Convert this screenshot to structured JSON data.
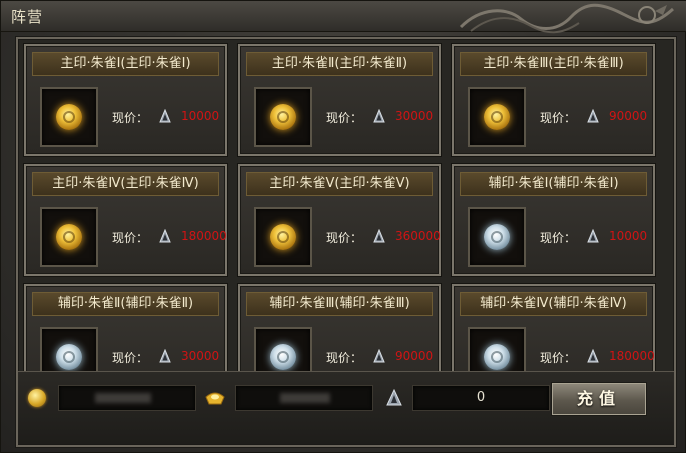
{
  "window": {
    "title": "阵营"
  },
  "cards": [
    {
      "title": "主印·朱雀Ⅰ(主印·朱雀Ⅰ)",
      "price_label": "现价：",
      "price": "10000",
      "seal": "gold"
    },
    {
      "title": "主印·朱雀Ⅱ(主印·朱雀Ⅱ)",
      "price_label": "现价：",
      "price": "30000",
      "seal": "gold"
    },
    {
      "title": "主印·朱雀Ⅲ(主印·朱雀Ⅲ)",
      "price_label": "现价：",
      "price": "90000",
      "seal": "gold"
    },
    {
      "title": "主印·朱雀Ⅳ(主印·朱雀Ⅳ)",
      "price_label": "现价：",
      "price": "180000",
      "seal": "gold"
    },
    {
      "title": "主印·朱雀Ⅴ(主印·朱雀Ⅴ)",
      "price_label": "现价：",
      "price": "360000",
      "seal": "gold"
    },
    {
      "title": "辅印·朱雀Ⅰ(辅印·朱雀Ⅰ)",
      "price_label": "现价：",
      "price": "10000",
      "seal": "silver"
    },
    {
      "title": "辅印·朱雀Ⅱ(辅印·朱雀Ⅱ)",
      "price_label": "现价：",
      "price": "30000",
      "seal": "silver"
    },
    {
      "title": "辅印·朱雀Ⅲ(辅印·朱雀Ⅲ)",
      "price_label": "现价：",
      "price": "90000",
      "seal": "silver"
    },
    {
      "title": "辅印·朱雀Ⅳ(辅印·朱雀Ⅳ)",
      "price_label": "现价：",
      "price": "180000",
      "seal": "silver"
    }
  ],
  "bottom": {
    "recharge_amount": "0",
    "recharge_label": "充值"
  },
  "icons": {
    "gold": "gold-coin-icon",
    "ingot": "gold-ingot-icon",
    "currency": "currency-crystal-icon"
  },
  "colors": {
    "price": "#d01414",
    "title_text": "#f2e9cd"
  }
}
